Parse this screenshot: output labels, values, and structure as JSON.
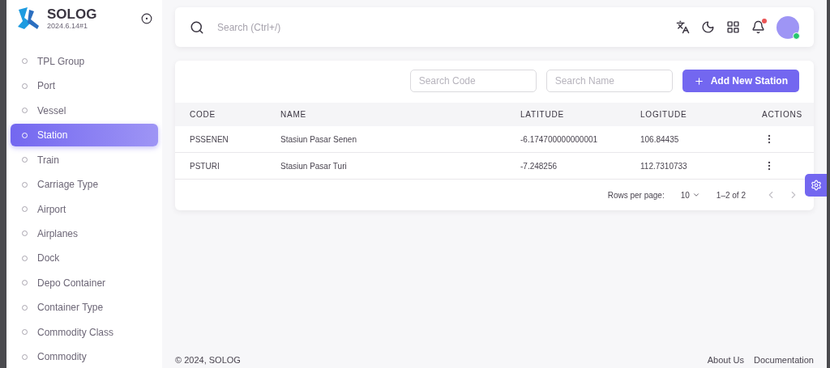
{
  "brand": {
    "name": "SOLOG",
    "version": "2024.6.14#1"
  },
  "sidebar": {
    "items": [
      {
        "label": "TPL Group",
        "selected": false
      },
      {
        "label": "Port",
        "selected": false
      },
      {
        "label": "Vessel",
        "selected": false
      },
      {
        "label": "Station",
        "selected": true
      },
      {
        "label": "Train",
        "selected": false
      },
      {
        "label": "Carriage Type",
        "selected": false
      },
      {
        "label": "Airport",
        "selected": false
      },
      {
        "label": "Airplanes",
        "selected": false
      },
      {
        "label": "Dock",
        "selected": false
      },
      {
        "label": "Depo Container",
        "selected": false
      },
      {
        "label": "Container Type",
        "selected": false
      },
      {
        "label": "Commodity Class",
        "selected": false
      },
      {
        "label": "Commodity",
        "selected": false
      }
    ]
  },
  "topbar": {
    "search": {
      "placeholder": "Search (Ctrl+/)"
    },
    "notifications_unread": true,
    "user_online": true
  },
  "filters": [
    {
      "placeholder": "Search Code"
    },
    {
      "placeholder": "Search Name"
    }
  ],
  "add_button": {
    "label": "Add New Station"
  },
  "table": {
    "columns": [
      "CODE",
      "NAME",
      "LATITUDE",
      "LOGITUDE",
      "ACTIONS"
    ],
    "rows": [
      [
        "PSSENEN",
        "Stasiun Pasar Senen",
        "-6.174700000000001",
        "106.84435"
      ],
      [
        "PSTURI",
        "Stasiun Pasar Turi",
        "-7.248256",
        "112.7310733"
      ]
    ]
  },
  "pagination": {
    "rows_per_page_label": "Rows per page:",
    "rows_per_page": "10",
    "range": "1–2 of 2",
    "prev_disabled": true,
    "next_disabled": true
  },
  "footer": {
    "copyright": "© 2024, SOLOG",
    "links": [
      "About Us",
      "Documentation"
    ]
  }
}
